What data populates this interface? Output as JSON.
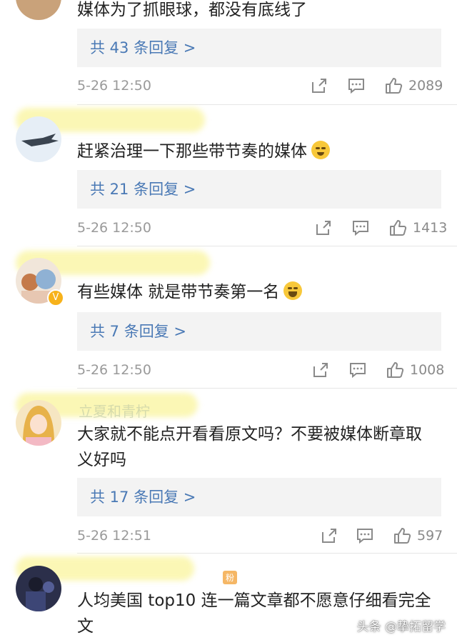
{
  "comments": [
    {
      "user_name": "",
      "text": "媒体为了抓眼球，都没有底线了",
      "reply_label": "共 43 条回复 >",
      "time": "5-26 12:50",
      "likes": "2089"
    },
    {
      "user_name": "",
      "text": "赶紧治理一下那些带节奏的媒体",
      "emoji": "smile-emoji",
      "reply_label": "共 21 条回复 >",
      "time": "5-26 12:50",
      "likes": "1413"
    },
    {
      "user_name": "",
      "verified": "V",
      "text": "有些媒体 就是带节奏第一名",
      "emoji": "laugh-emoji",
      "reply_label": "共 7 条回复 >",
      "time": "5-26 12:50",
      "likes": "1008"
    },
    {
      "user_name": "立夏和青柠",
      "text": "大家就不能点开看看原文吗？不要被媒体断章取义好吗",
      "reply_label": "共 17 条回复 >",
      "time": "5-26 12:51",
      "likes": "597"
    },
    {
      "user_name": "",
      "badge": "粉",
      "text": "人均美国 top10 连一篇文章都不愿意仔细看完全文"
    }
  ],
  "watermark": "头条 @挚拓留学",
  "colors": {
    "link": "#4a79b5",
    "reply_bg": "#f3f3f3",
    "meta": "#9a9a9a"
  }
}
